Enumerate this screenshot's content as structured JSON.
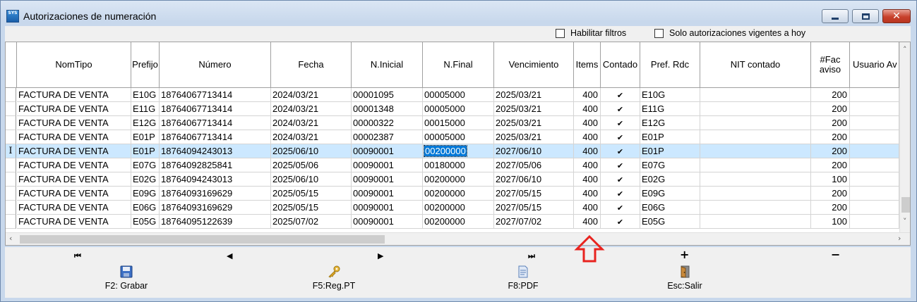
{
  "window": {
    "title": "Autorizaciones de numeración",
    "app_icon_text": "SYS"
  },
  "filters": {
    "habilitar_filtros": "Habilitar filtros",
    "solo_vigentes": "Solo autorizaciones vigentes a hoy"
  },
  "columns": {
    "nomtipo": "NomTipo",
    "prefijo": "Prefijo",
    "numero": "Número",
    "fecha": "Fecha",
    "ninicial": "N.Inicial",
    "nfinal": "N.Final",
    "vencimiento": "Vencimiento",
    "items": "Items",
    "contado": "Contado",
    "prefrdc": "Pref. Rdc",
    "nitcontado": "NIT contado",
    "facaviso_1": "#Fac",
    "facaviso_2": "aviso",
    "usuario": "Usuario Av"
  },
  "rows": [
    {
      "nomtipo": "FACTURA DE VENTA",
      "prefijo": "E10G",
      "numero": "18764067713414",
      "fecha": "2024/03/21",
      "ninicial": "00001095",
      "nfinal": "00005000",
      "vencimiento": "2025/03/21",
      "items": "400",
      "prefrdc": "E10G",
      "facaviso": "200",
      "marker": ""
    },
    {
      "nomtipo": "FACTURA DE VENTA",
      "prefijo": "E11G",
      "numero": "18764067713414",
      "fecha": "2024/03/21",
      "ninicial": "00001348",
      "nfinal": "00005000",
      "vencimiento": "2025/03/21",
      "items": "400",
      "prefrdc": "E11G",
      "facaviso": "200",
      "marker": ""
    },
    {
      "nomtipo": "FACTURA DE VENTA",
      "prefijo": "E12G",
      "numero": "18764067713414",
      "fecha": "2024/03/21",
      "ninicial": "00000322",
      "nfinal": "00015000",
      "vencimiento": "2025/03/21",
      "items": "400",
      "prefrdc": "E12G",
      "facaviso": "200",
      "marker": ""
    },
    {
      "nomtipo": "FACTURA DE VENTA",
      "prefijo": "E01P",
      "numero": "18764067713414",
      "fecha": "2024/03/21",
      "ninicial": "00002387",
      "nfinal": "00005000",
      "vencimiento": "2025/03/21",
      "items": "400",
      "prefrdc": "E01P",
      "facaviso": "200",
      "marker": ""
    },
    {
      "nomtipo": "FACTURA DE VENTA",
      "prefijo": "E01P",
      "numero": "18764094243013",
      "fecha": "2025/06/10",
      "ninicial": "00090001",
      "nfinal": "00200000",
      "vencimiento": "2027/06/10",
      "items": "400",
      "prefrdc": "E01P",
      "facaviso": "200",
      "marker": "I"
    },
    {
      "nomtipo": "FACTURA DE VENTA",
      "prefijo": "E07G",
      "numero": "18764092825841",
      "fecha": "2025/05/06",
      "ninicial": "00090001",
      "nfinal": "00180000",
      "vencimiento": "2027/05/06",
      "items": "400",
      "prefrdc": "E07G",
      "facaviso": "200",
      "marker": ""
    },
    {
      "nomtipo": "FACTURA DE VENTA",
      "prefijo": "E02G",
      "numero": "18764094243013",
      "fecha": "2025/06/10",
      "ninicial": "00090001",
      "nfinal": "00200000",
      "vencimiento": "2027/06/10",
      "items": "400",
      "prefrdc": "E02G",
      "facaviso": "100",
      "marker": ""
    },
    {
      "nomtipo": "FACTURA DE VENTA",
      "prefijo": "E09G",
      "numero": "18764093169629",
      "fecha": "2025/05/15",
      "ninicial": "00090001",
      "nfinal": "00200000",
      "vencimiento": "2027/05/15",
      "items": "400",
      "prefrdc": "E09G",
      "facaviso": "200",
      "marker": ""
    },
    {
      "nomtipo": "FACTURA DE VENTA",
      "prefijo": "E06G",
      "numero": "18764093169629",
      "fecha": "2025/05/15",
      "ninicial": "00090001",
      "nfinal": "00200000",
      "vencimiento": "2027/05/15",
      "items": "400",
      "prefrdc": "E06G",
      "facaviso": "200",
      "marker": ""
    },
    {
      "nomtipo": "FACTURA DE VENTA",
      "prefijo": "E05G",
      "numero": "18764095122639",
      "fecha": "2025/07/02",
      "ninicial": "00090001",
      "nfinal": "00200000",
      "vencimiento": "2027/07/02",
      "items": "400",
      "prefrdc": "E05G",
      "facaviso": "100",
      "marker": ""
    }
  ],
  "navigator": {
    "first": "⏮",
    "prior": "◀",
    "next": "▶",
    "last": "⏭",
    "insert": "+",
    "delete": "−"
  },
  "toolbar": {
    "grabar": "F2: Grabar",
    "regpt": "F5:Reg.PT",
    "pdf": "F8:PDF",
    "salir": "Esc:Salir"
  },
  "icons": {
    "save": "floppy-disk-icon",
    "key": "key-icon",
    "pdf": "document-icon",
    "exit": "door-exit-icon"
  },
  "colors": {
    "selected_row": "#cce8ff",
    "edit_highlight": "#0078d7",
    "annotation_arrow": "#e8231f",
    "close_button": "#c8412c"
  }
}
